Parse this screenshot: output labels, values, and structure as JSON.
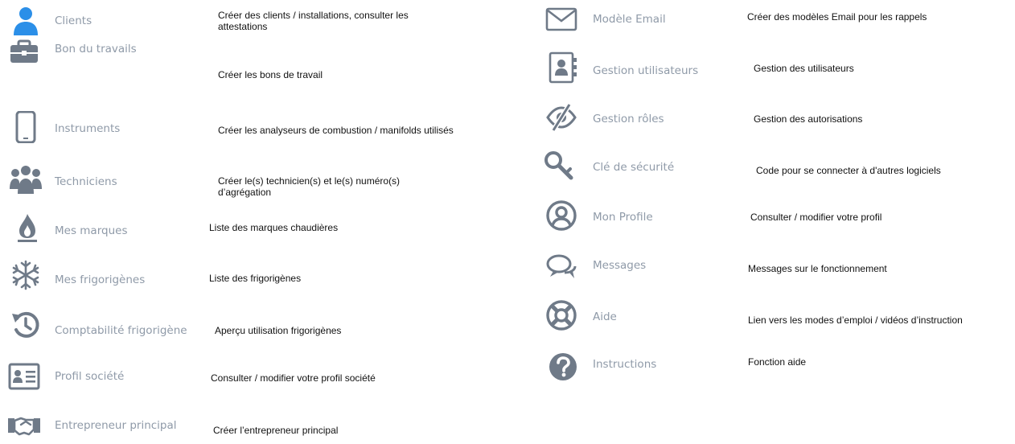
{
  "left_items": [
    {
      "label": "Clients",
      "desc": "Créer des clients / installations, consulter les attestations",
      "icon": "user-icon"
    },
    {
      "label": "Bon du travails",
      "desc": "Créer les bons de travail",
      "icon": "briefcase-icon"
    },
    {
      "label": "Instruments",
      "desc": "Créer les analyseurs de combustion / manifolds utilisés",
      "icon": "mobile-device-icon"
    },
    {
      "label": "Techniciens",
      "desc": "Créer le(s) technicien(s) et le(s) numéro(s) d’agrégation",
      "icon": "users-group-icon"
    },
    {
      "label": "Mes marques",
      "desc": "Liste des marques chaudières",
      "icon": "flame-icon"
    },
    {
      "label": "Mes frigorigènes",
      "desc": "Liste des frigorigènes",
      "icon": "snowflake-icon"
    },
    {
      "label": "Comptabilité frigorigène",
      "desc": "Aperçu utilisation frigorigènes",
      "icon": "history-clock-icon"
    },
    {
      "label": "Profil société",
      "desc": "Consulter / modifier votre profil société",
      "icon": "id-card-icon"
    },
    {
      "label": "Entrepreneur principal",
      "desc": "Créer l’entrepreneur principal",
      "icon": "handshake-icon"
    }
  ],
  "right_items": [
    {
      "label": "Modèle Email",
      "desc": "Créer des modèles Email pour les rappels",
      "icon": "envelope-icon"
    },
    {
      "label": "Gestion utilisateurs",
      "desc": "Gestion des utilisateurs",
      "icon": "contact-book-icon"
    },
    {
      "label": "Gestion rôles",
      "desc": "Gestion des autorisations",
      "icon": "eye-slash-icon"
    },
    {
      "label": "Clé de sécurité",
      "desc": "Code pour se connecter à d'autres logiciels",
      "icon": "key-icon"
    },
    {
      "label": "Mon Profile",
      "desc": "Consulter / modifier votre profil",
      "icon": "profile-circle-icon"
    },
    {
      "label": "Messages",
      "desc": "Messages sur le fonctionnement",
      "icon": "chat-bubbles-icon"
    },
    {
      "label": "Aide",
      "desc": "Lien vers les modes d’emploi / vidéos d’instruction",
      "icon": "lifebuoy-icon"
    },
    {
      "label": "Instructions",
      "desc": "Fonction aide",
      "icon": "question-circle-icon"
    }
  ],
  "colors": {
    "accent": "#2b8fe8",
    "icon_gray": "#6f7a88",
    "label_gray": "#8f9aa8"
  }
}
